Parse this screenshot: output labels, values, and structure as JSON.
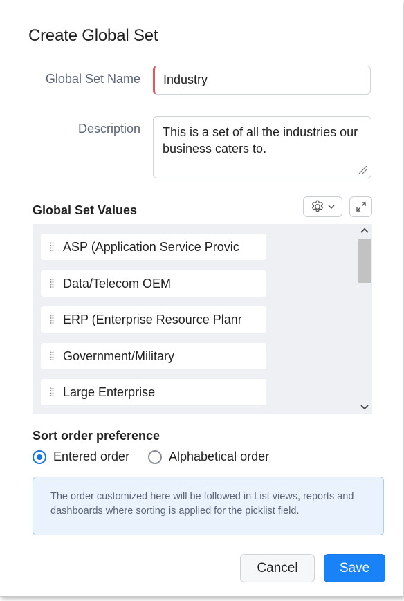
{
  "dialog": {
    "title": "Create Global Set",
    "name_label": "Global Set Name",
    "name_value": "Industry",
    "description_label": "Description",
    "description_value": "This is a set of all the industries our business caters to."
  },
  "values": {
    "title": "Global Set Values",
    "items": [
      {
        "label": "ASP (Application Service Provic"
      },
      {
        "label": "Data/Telecom OEM"
      },
      {
        "label": "ERP (Enterprise Resource Planr"
      },
      {
        "label": "Government/Military"
      },
      {
        "label": "Large Enterprise"
      }
    ]
  },
  "sort": {
    "title": "Sort order preference",
    "options": [
      {
        "label": "Entered order",
        "selected": true
      },
      {
        "label": "Alphabetical order",
        "selected": false
      }
    ]
  },
  "info": {
    "text": "The order customized here will be followed in List views, reports and dashboards where sorting is applied for the picklist field."
  },
  "buttons": {
    "cancel": "Cancel",
    "save": "Save"
  },
  "colors": {
    "accent": "#1a82f7",
    "required_marker": "#e05a5a",
    "info_bg": "#eaf3fd"
  }
}
